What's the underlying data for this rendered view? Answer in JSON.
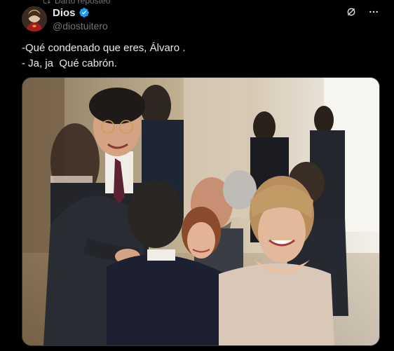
{
  "post": {
    "repost_label": "Darto reposteó",
    "author": {
      "display_name": "Dios",
      "handle": "@diostuitero",
      "verified": true,
      "avatar_icon": "sacred-heart-avatar"
    },
    "text": "-Qué condenado que eres, Álvaro .\n- Ja, ja  Qué cabrón.",
    "actions": {
      "grok_icon": "grok-icon",
      "more_icon": "more-icon"
    }
  },
  "colors": {
    "background": "#000000",
    "text_primary": "#e7e9ea",
    "text_secondary": "#71767b",
    "verified_blue": "#1d9bf0"
  }
}
